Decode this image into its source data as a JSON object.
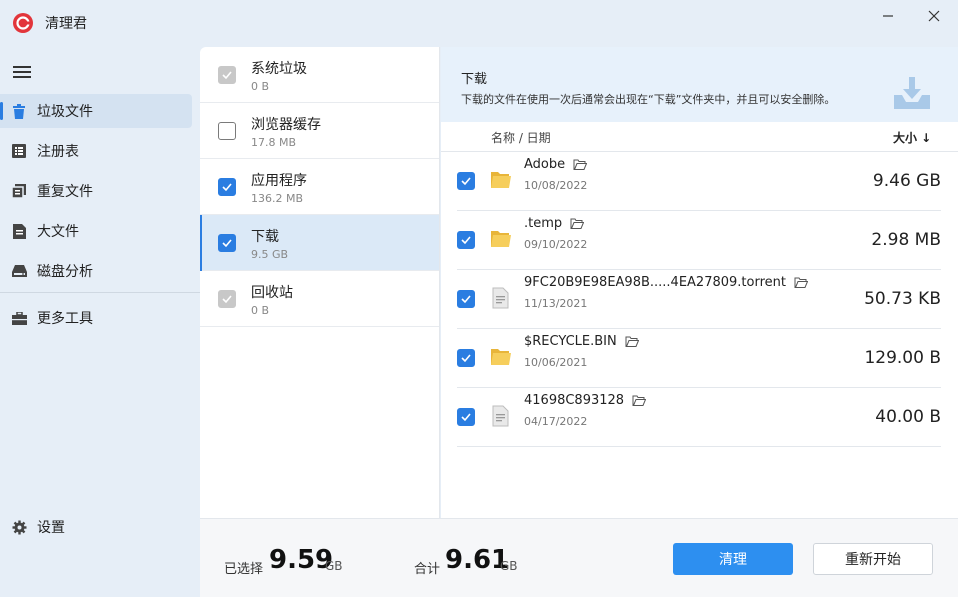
{
  "app": {
    "title": "清理君",
    "brand_color": "#e2353b",
    "accent_color": "#2a7de1"
  },
  "window": {
    "minimize_icon": "minimize-icon",
    "close_icon": "close-icon"
  },
  "sidebar": {
    "menu_icon": "hamburger-icon",
    "items": [
      {
        "label": "垃圾文件",
        "icon": "trash-icon",
        "active": true
      },
      {
        "label": "注册表",
        "icon": "list-icon",
        "active": false
      },
      {
        "label": "重复文件",
        "icon": "duplicate-icon",
        "active": false
      },
      {
        "label": "大文件",
        "icon": "document-icon",
        "active": false
      },
      {
        "label": "磁盘分析",
        "icon": "disk-icon",
        "active": false
      },
      {
        "label": "更多工具",
        "icon": "toolbox-icon",
        "active": false
      }
    ],
    "settings_label": "设置",
    "settings_icon": "gear-icon"
  },
  "categories": [
    {
      "name": "系统垃圾",
      "size": "0 B",
      "check": "grey"
    },
    {
      "name": "浏览器缓存",
      "size": "17.8 MB",
      "check": "empty"
    },
    {
      "name": "应用程序",
      "size": "136.2 MB",
      "check": "blue"
    },
    {
      "name": "下载",
      "size": "9.5 GB",
      "check": "blue",
      "active": true
    },
    {
      "name": "回收站",
      "size": "0 B",
      "check": "grey"
    }
  ],
  "detail": {
    "title": "下载",
    "description": "下载的文件在使用一次后通常会出现在“下载”文件夹中，并且可以安全删除。",
    "col_name": "名称 / 日期",
    "col_size": "大小 ↓",
    "files": [
      {
        "name": "Adobe",
        "date": "10/08/2022",
        "size": "9.46 GB",
        "type": "folder"
      },
      {
        "name": ".temp",
        "date": "09/10/2022",
        "size": "2.98 MB",
        "type": "folder"
      },
      {
        "name": "9FC20B9E98EA98B.....4EA27809.torrent",
        "date": "11/13/2021",
        "size": "50.73 KB",
        "type": "file"
      },
      {
        "name": "$RECYCLE.BIN",
        "date": "10/06/2021",
        "size": "129.00 B",
        "type": "folder"
      },
      {
        "name": "41698C893128",
        "date": "04/17/2022",
        "size": "40.00 B",
        "type": "file"
      }
    ]
  },
  "footer": {
    "selected_label": "已选择",
    "selected_value": "9.59",
    "selected_unit": "GB",
    "total_label": "合计",
    "total_value": "9.61",
    "total_unit": "GB",
    "clean_button": "清理",
    "restart_button": "重新开始"
  }
}
